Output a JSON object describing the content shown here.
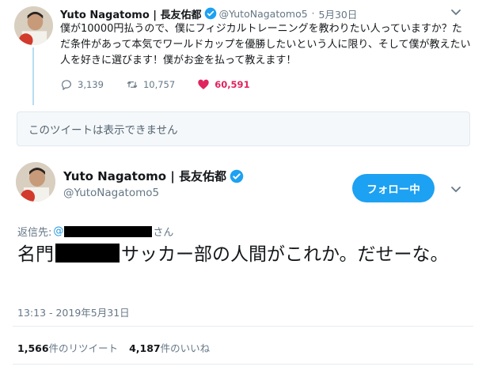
{
  "tweet1": {
    "name": "Yuto Nagatomo | 長友佑都",
    "handle": "@YutoNagatomo5",
    "separator": "·",
    "date": "5月30日",
    "text": "僕が10000円払うので、僕にフィジカルトレーニングを教わりたい人っていますか？ただ条件があって本気でワールドカップを優勝したいという人に限り、そして僕が教えたい人を好きに選びます！僕がお金を払って教えます！",
    "replies": "3,139",
    "retweets": "10,757",
    "likes": "60,591",
    "icons": [
      "reply-icon",
      "retweet-icon",
      "heart-icon",
      "chevron-down-icon",
      "verified-icon"
    ],
    "like_color": "#e0245e"
  },
  "unavailable_text": "このツイートは表示できません",
  "tweet2": {
    "name": "Yuto Nagatomo | 長友佑都",
    "handle": "@YutoNagatomo5",
    "follow_label": "フォロー中",
    "reply_prefix": "返信先:",
    "reply_at": "@",
    "reply_suffix": "さん",
    "text_part1": "名門",
    "text_part2": "サッカー部の人間がこれか。だせーな。",
    "timestamp": "13:13 - 2019年5月31日",
    "retweet_count": "1,566",
    "retweet_label": "件のリツイート",
    "like_count": "4,187",
    "like_label": "件のいいね",
    "accent": "#1da1f2"
  }
}
